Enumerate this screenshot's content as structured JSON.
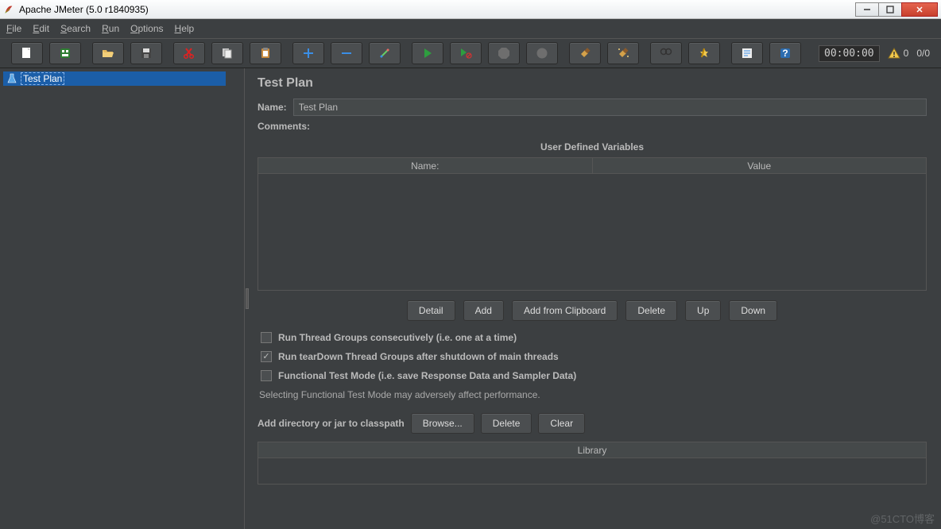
{
  "window": {
    "title": "Apache JMeter (5.0 r1840935)"
  },
  "menu": {
    "file": "File",
    "edit": "Edit",
    "search": "Search",
    "run": "Run",
    "options": "Options",
    "help": "Help"
  },
  "toolbar": {
    "time": "00:00:00",
    "warn_count": "0",
    "run_count": "0/0"
  },
  "tree": {
    "root": "Test Plan"
  },
  "panel": {
    "title": "Test Plan",
    "name_label": "Name:",
    "name_value": "Test Plan",
    "comments_label": "Comments:",
    "udv_title": "User Defined Variables",
    "col_name": "Name:",
    "col_value": "Value",
    "buttons": {
      "detail": "Detail",
      "add": "Add",
      "add_clip": "Add from Clipboard",
      "delete": "Delete",
      "up": "Up",
      "down": "Down"
    },
    "chk_consecutive": "Run Thread Groups consecutively (i.e. one at a time)",
    "chk_teardown": "Run tearDown Thread Groups after shutdown of main threads",
    "chk_functional": "Functional Test Mode (i.e. save Response Data and Sampler Data)",
    "note": "Selecting Functional Test Mode may adversely affect performance.",
    "classpath_label": "Add directory or jar to classpath",
    "browse": "Browse...",
    "cp_delete": "Delete",
    "clear": "Clear",
    "lib_header": "Library"
  },
  "watermark": "@51CTO博客"
}
